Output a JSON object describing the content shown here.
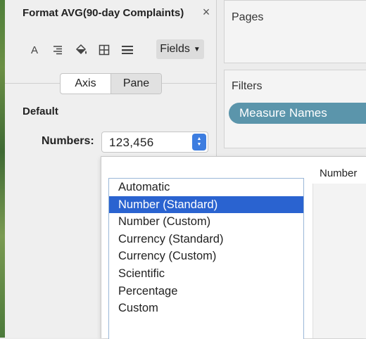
{
  "format_pane": {
    "title": "Format AVG(90-day Complaints)",
    "close_glyph": "×",
    "toolbar": {
      "icons": [
        "font-icon",
        "alignment-icon",
        "shading-icon",
        "borders-icon",
        "lines-icon"
      ],
      "font_glyph": "A",
      "fields_label": "Fields",
      "fields_caret": "▼"
    },
    "tabs": [
      {
        "label": "Axis",
        "selected": false
      },
      {
        "label": "Pane",
        "selected": true
      }
    ],
    "section_heading": "Default",
    "numbers": {
      "label": "Numbers:",
      "value": "123,456"
    }
  },
  "shelves": {
    "pages_title": "Pages",
    "filters_title": "Filters",
    "filter_pill": "Measure Names"
  },
  "number_format_popup": {
    "options": [
      "Automatic",
      "Number (Standard)",
      "Number (Custom)",
      "Currency (Standard)",
      "Currency (Custom)",
      "Scientific",
      "Percentage",
      "Custom"
    ],
    "selected_option": "Number (Standard)",
    "preview_label": "Number"
  },
  "colors": {
    "selection": "#2a63d0",
    "pill": "#5b95ab",
    "stepper": "#3d7de0"
  }
}
